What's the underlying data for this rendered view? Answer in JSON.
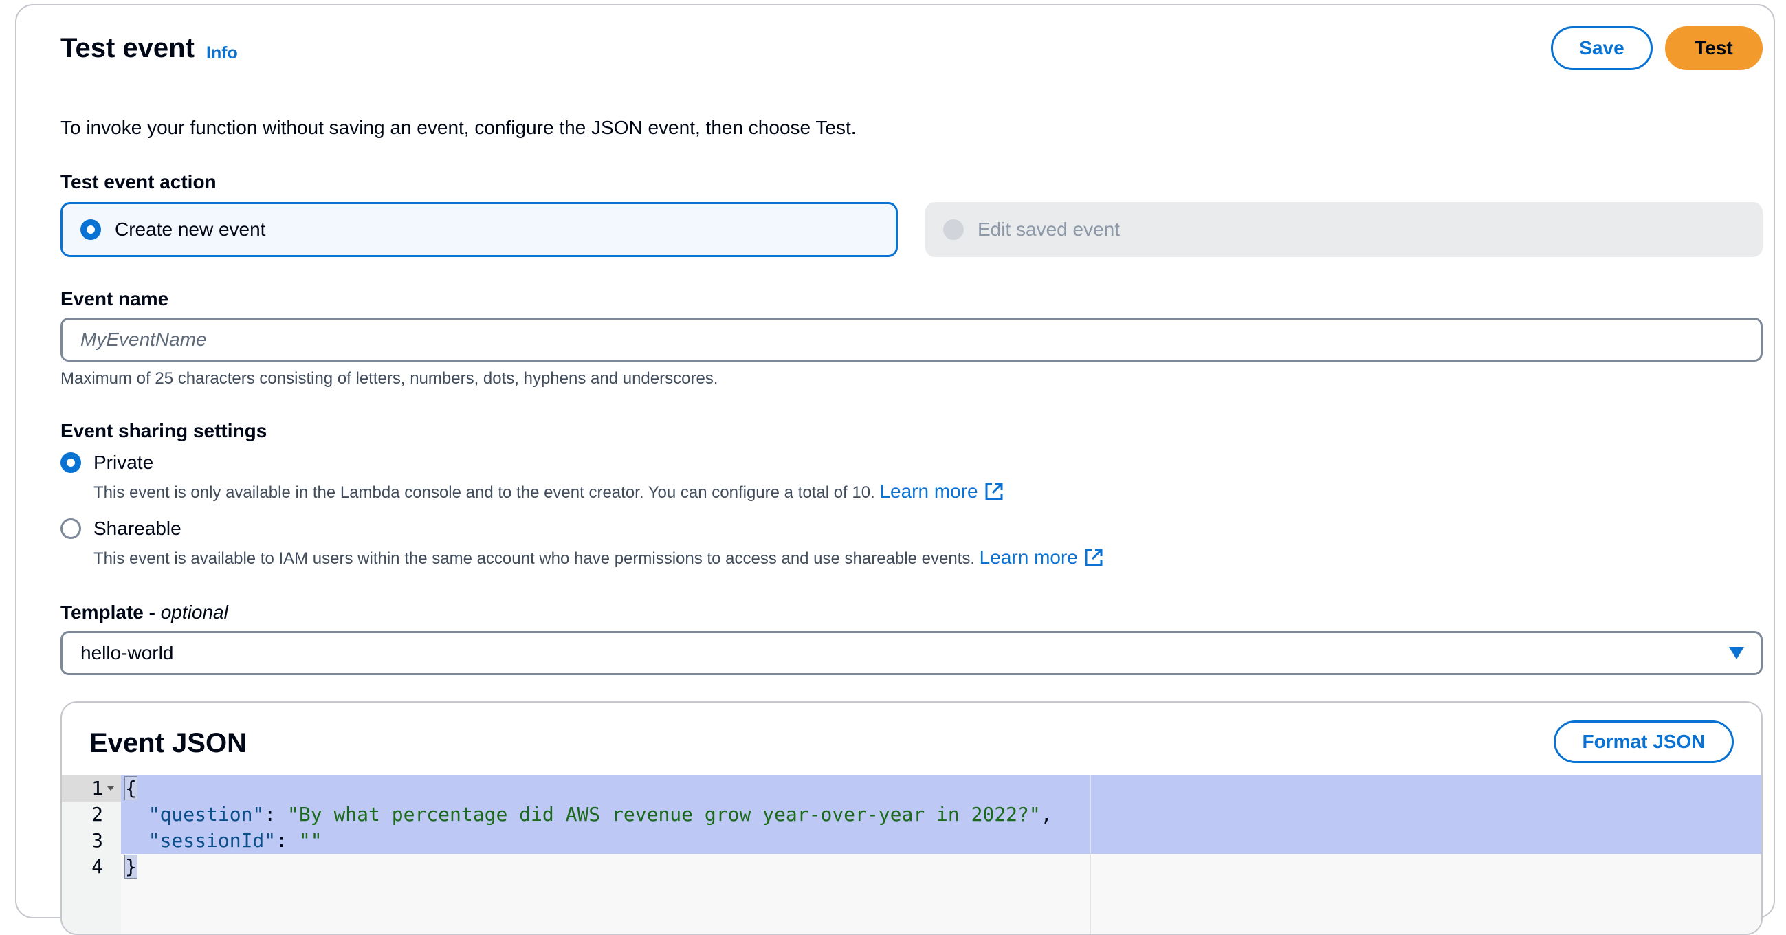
{
  "header": {
    "title": "Test event",
    "info_link": "Info",
    "save_label": "Save",
    "test_label": "Test"
  },
  "description": "To invoke your function without saving an event, configure the JSON event, then choose Test.",
  "test_event_action": {
    "label": "Test event action",
    "options": [
      {
        "label": "Create new event",
        "selected": true,
        "disabled": false
      },
      {
        "label": "Edit saved event",
        "selected": false,
        "disabled": true
      }
    ]
  },
  "event_name": {
    "label": "Event name",
    "value": "",
    "placeholder": "MyEventName",
    "hint": "Maximum of 25 characters consisting of letters, numbers, dots, hyphens and underscores."
  },
  "sharing": {
    "label": "Event sharing settings",
    "options": [
      {
        "label": "Private",
        "selected": true,
        "description": "This event is only available in the Lambda console and to the event creator. You can configure a total of 10.",
        "learn_more": "Learn more"
      },
      {
        "label": "Shareable",
        "selected": false,
        "description": "This event is available to IAM users within the same account who have permissions to access and use shareable events.",
        "learn_more": "Learn more"
      }
    ]
  },
  "template": {
    "label": "Template -",
    "label_optional": "optional",
    "selected": "hello-world"
  },
  "event_json": {
    "title": "Event JSON",
    "format_label": "Format JSON",
    "line_numbers": [
      "1",
      "2",
      "3",
      "4"
    ],
    "lines": {
      "l1_open": "{",
      "l2_key": "\"question\"",
      "l2_sep": ": ",
      "l2_val": "\"By what percentage did AWS revenue grow year-over-year in 2022?\"",
      "l2_end": ",",
      "l3_key": "\"sessionId\"",
      "l3_sep": ": ",
      "l3_val": "\"\"",
      "l4_close": "}"
    }
  },
  "colors": {
    "accent": "#0972d3",
    "primary_button": "#f39a2c",
    "selection": "#bdc8f5"
  },
  "icons": {
    "external_link": "external-link-icon",
    "dropdown": "caret-down-icon",
    "fold": "fold-arrow-icon"
  }
}
